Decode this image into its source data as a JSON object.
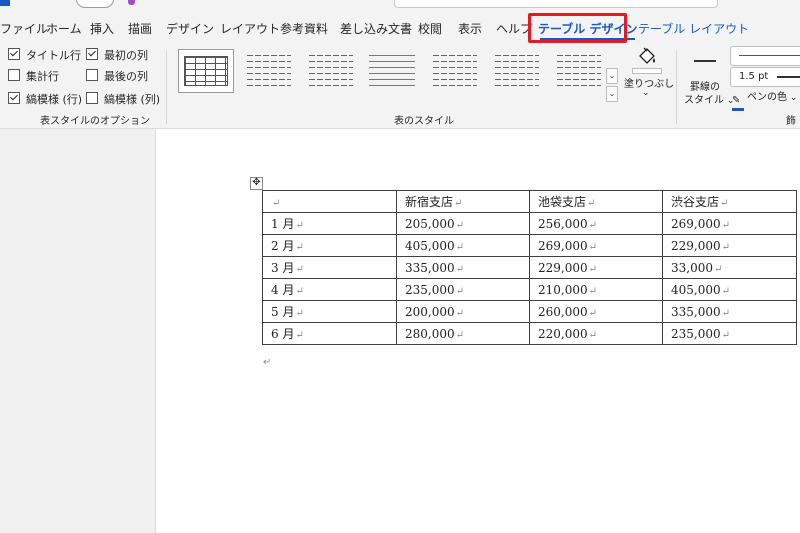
{
  "tabs": [
    {
      "label": "ファイル",
      "state": "normal"
    },
    {
      "label": "ホーム",
      "state": "normal"
    },
    {
      "label": "挿入",
      "state": "normal"
    },
    {
      "label": "描画",
      "state": "normal"
    },
    {
      "label": "デザイン",
      "state": "normal"
    },
    {
      "label": "レイアウト",
      "state": "normal"
    },
    {
      "label": "参考資料",
      "state": "normal"
    },
    {
      "label": "差し込み文書",
      "state": "normal"
    },
    {
      "label": "校閲",
      "state": "normal"
    },
    {
      "label": "表示",
      "state": "normal"
    },
    {
      "label": "ヘルプ",
      "state": "normal"
    },
    {
      "label": "テーブル デザイン",
      "state": "active"
    },
    {
      "label": "テーブル レイアウト",
      "state": "contextual"
    }
  ],
  "ribbon": {
    "style_options": {
      "group_label": "表スタイルのオプション",
      "items": [
        {
          "label": "タイトル行",
          "checked": true
        },
        {
          "label": "最初の列",
          "checked": true
        },
        {
          "label": "集計行",
          "checked": false
        },
        {
          "label": "最後の列",
          "checked": false
        },
        {
          "label": "縞模様 (行)",
          "checked": true
        },
        {
          "label": "縞模様 (列)",
          "checked": false
        }
      ]
    },
    "table_styles": {
      "group_label": "表のスタイル",
      "gallery_count": 7
    },
    "shading": {
      "label": "塗りつぶし"
    },
    "borders": {
      "border_styles_label": "罫線の",
      "border_styles_label2": "スタイル",
      "weight": "1.5 pt",
      "pen_color_label": "ペンの色",
      "group_label_partial": "飾"
    }
  },
  "document": {
    "paragraph_mark": "↵",
    "table": {
      "rows": [
        [
          "",
          "新宿支店",
          "池袋支店",
          "渋谷支店"
        ],
        [
          "1 月",
          "205,000",
          "256,000",
          "269,000"
        ],
        [
          "2 月",
          "405,000",
          "269,000",
          "229,000"
        ],
        [
          "3 月",
          "335,000",
          "229,000",
          "33,000"
        ],
        [
          "4 月",
          "235,000",
          "210,000",
          "405,000"
        ],
        [
          "5 月",
          "200,000",
          "260,000",
          "335,000"
        ],
        [
          "6 月",
          "280,000",
          "220,000",
          "235,000"
        ]
      ]
    }
  },
  "colors": {
    "accent": "#185abd",
    "highlight_box": "#e01b24"
  }
}
